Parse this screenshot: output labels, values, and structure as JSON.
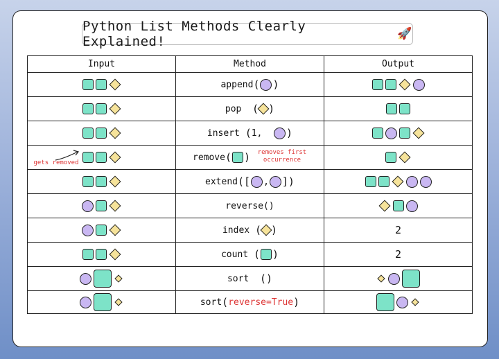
{
  "title": "Python List Methods Clearly Explained!",
  "headers": {
    "input": "Input",
    "method": "Method",
    "output": "Output"
  },
  "notes": {
    "gets_removed": "gets removed",
    "removes_first": "removes first occurrence"
  },
  "methods": {
    "append": "append",
    "pop": "pop",
    "insert": "insert",
    "insert_arg": "1,",
    "remove": "remove",
    "extend": "extend",
    "reverse": "reverse()",
    "index": "index",
    "count": "count",
    "sort": "sort",
    "sort_rev": "sort",
    "sort_rev_arg": "reverse=True"
  },
  "outputs": {
    "index": "2",
    "count": "2"
  },
  "colors": {
    "square": "#7de3c8",
    "circle": "#c9b7f2",
    "diamond": "#f6e39a"
  }
}
